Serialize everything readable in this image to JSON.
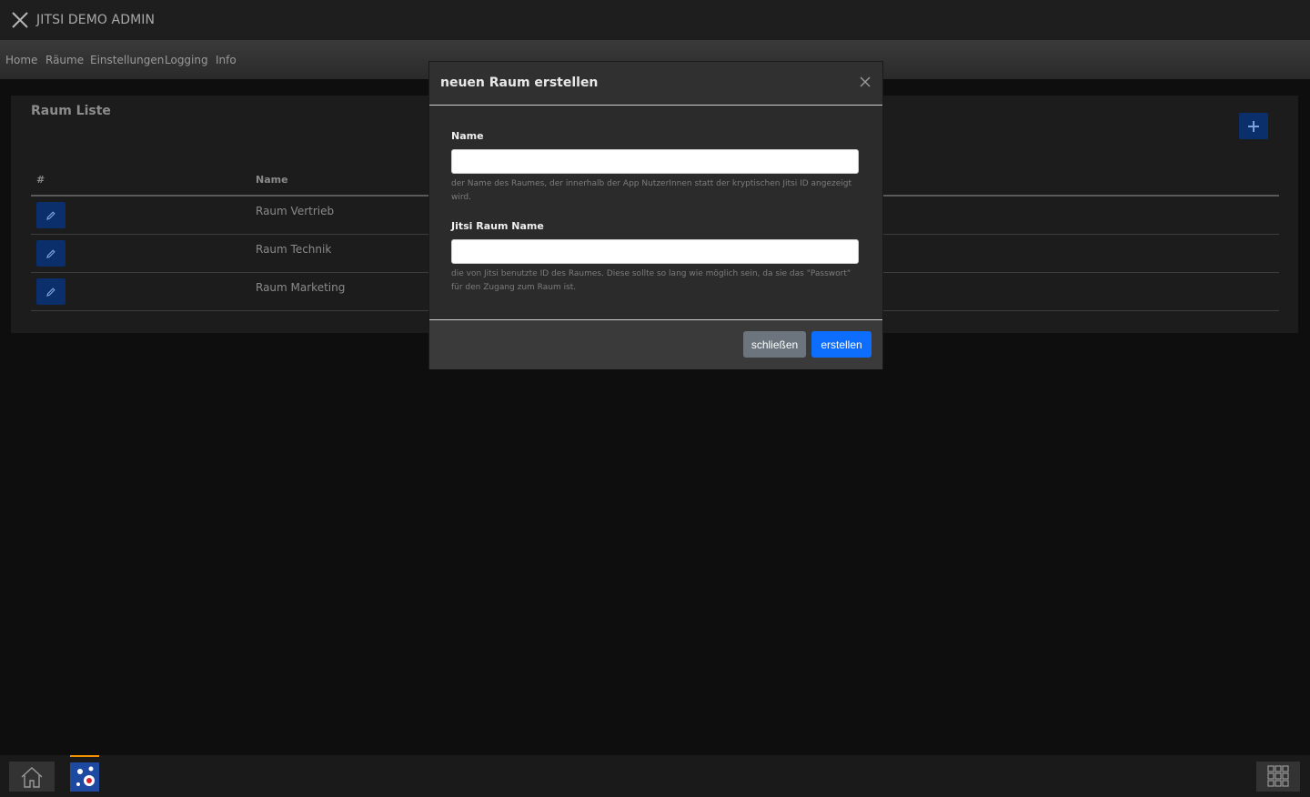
{
  "window": {
    "title": "JITSI DEMO ADMIN"
  },
  "nav": {
    "items": [
      "Home",
      "Räume",
      "Einstellungen",
      "Logging",
      "Info"
    ]
  },
  "room_list": {
    "title": "Raum Liste",
    "columns": [
      "#",
      "Name"
    ],
    "rows": [
      {
        "name": "Raum Vertrieb"
      },
      {
        "name": "Raum Technik"
      },
      {
        "name": "Raum Marketing"
      }
    ],
    "add_icon": "plus-icon",
    "edit_icon": "pencil-icon"
  },
  "modal": {
    "title": "neuen Raum erstellen",
    "name_label": "Name",
    "name_value": "",
    "name_help": "der Name des Raumes, der innerhalb der App NutzerInnen statt der kryptischen Jitsi ID angezeigt wird.",
    "jitsi_label": "Jitsi Raum Name",
    "jitsi_value": "",
    "jitsi_help": "die von Jitsi benutzte ID des Raumes. Diese sollte so lang wie möglich sein, da sie das \"Passwort\" für den Zugang zum Raum ist.",
    "close_button": "schließen",
    "create_button": "erstellen"
  },
  "colors": {
    "primary": "#0d6efd",
    "secondary": "#6c757d",
    "accent": "#f39200"
  }
}
